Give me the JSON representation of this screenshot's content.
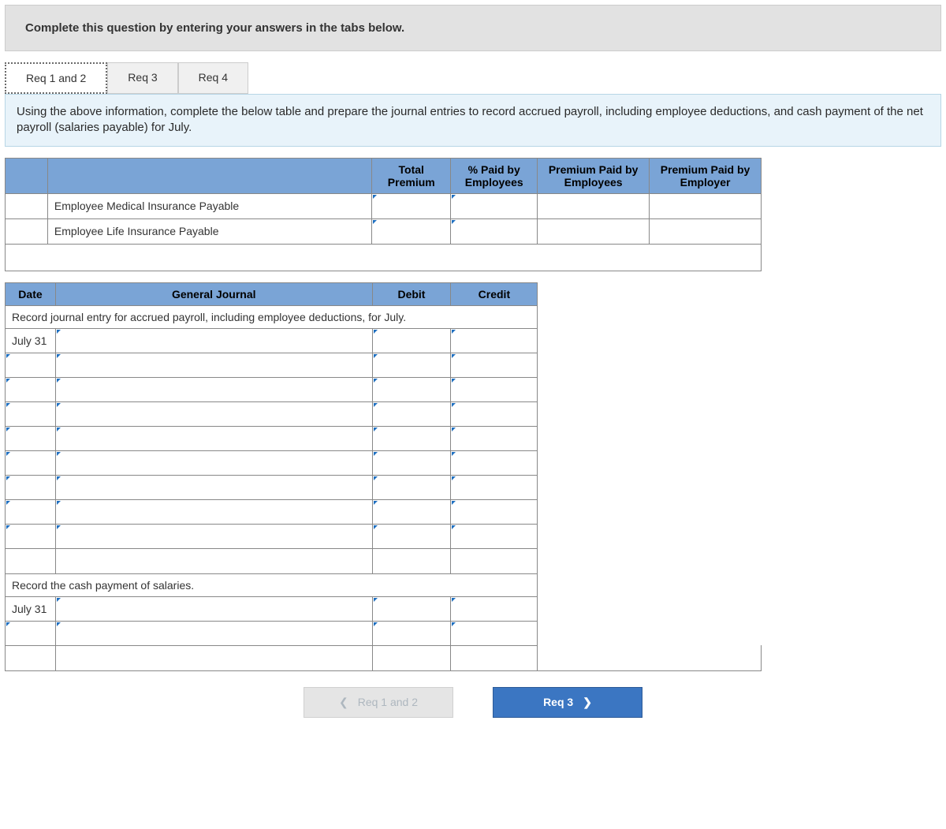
{
  "instruction": "Complete this question by entering your answers in the tabs below.",
  "tabs": {
    "t1": "Req 1 and 2",
    "t2": "Req 3",
    "t3": "Req 4"
  },
  "sub_instruction": "Using the above information, complete the below table and prepare the journal entries to record accrued payroll, including employee deductions, and cash payment of the net payroll (salaries payable) for July.",
  "premium": {
    "headers": {
      "total": "Total Premium",
      "pct": "% Paid by Employees",
      "paid_emp": "Premium Paid by Employees",
      "paid_empr": "Premium Paid by Employer"
    },
    "rows": {
      "r1": "Employee Medical Insurance Payable",
      "r2": "Employee Life Insurance Payable"
    }
  },
  "journal": {
    "headers": {
      "date": "Date",
      "gj": "General Journal",
      "debit": "Debit",
      "credit": "Credit"
    },
    "instr1": "Record journal entry for accrued payroll, including employee deductions, for July.",
    "date1": "July 31",
    "instr2": "Record the cash payment of salaries.",
    "date2": "July 31"
  },
  "nav": {
    "prev": "Req 1 and 2",
    "next": "Req 3"
  }
}
